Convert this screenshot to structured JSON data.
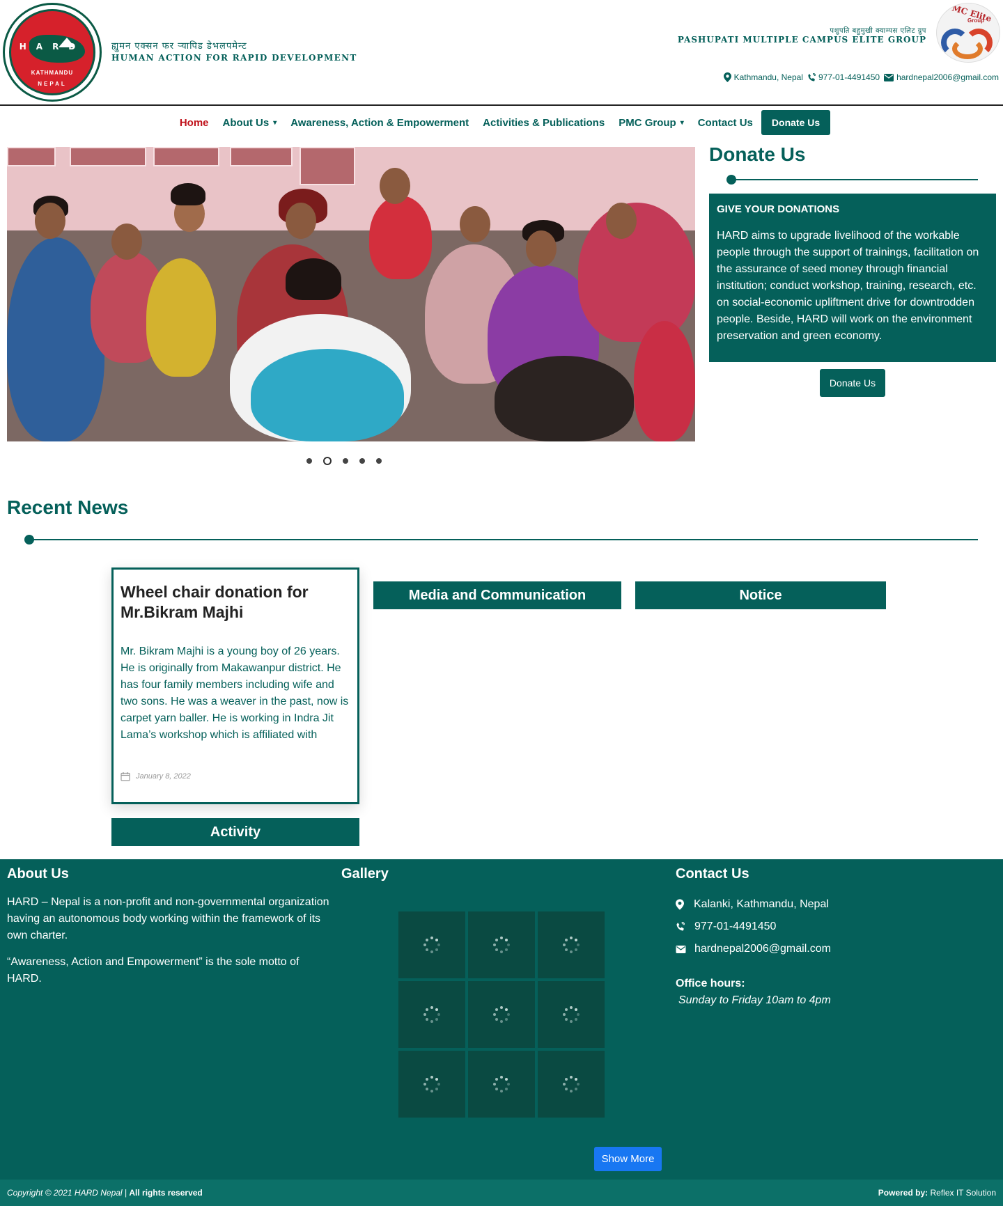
{
  "header": {
    "org_name_nepali": "ह्युमन एक्सन फर र्‍यापिड डेभलपमेन्ट",
    "org_name_english": "HUMAN ACTION FOR RAPID DEVELOPMENT",
    "logo_letters": "HARD",
    "logo_city": "KATHMANDU",
    "logo_country": "NEPAL",
    "pmc_nepali": "पशुपति बहुमुखी क्याम्पस एलिट ग्रुप",
    "pmc_english": "PASHUPATI MULTIPLE CAMPUS ELITE GROUP",
    "pmc_logo_line1": "PMC Elite",
    "pmc_logo_line2": "Group",
    "contact": {
      "location": "Kathmandu, Nepal",
      "phone": "977-01-4491450",
      "email": "hardnepal2006@gmail.com"
    }
  },
  "nav": {
    "items": [
      {
        "label": "Home",
        "active": true,
        "has_dropdown": false
      },
      {
        "label": "About Us",
        "active": false,
        "has_dropdown": true
      },
      {
        "label": "Awareness, Action & Empowerment",
        "active": false,
        "has_dropdown": false
      },
      {
        "label": "Activities & Publications",
        "active": false,
        "has_dropdown": false
      },
      {
        "label": "PMC Group",
        "active": false,
        "has_dropdown": true
      },
      {
        "label": "Contact Us",
        "active": false,
        "has_dropdown": false
      }
    ],
    "donate_label": "Donate Us"
  },
  "slider": {
    "slide_count": 5,
    "current_index": 1
  },
  "donate": {
    "title": "Donate Us",
    "box_heading": "GIVE YOUR DONATIONS",
    "box_text": "HARD aims to upgrade livelihood of the workable people through the support of trainings, facilitation on the assurance of seed money through financial institution; conduct workshop, training, research, etc. on social-economic upliftment drive for downtrodden people. Beside, HARD will work on the environment preservation and green economy.",
    "button_label": "Donate Us"
  },
  "news": {
    "title": "Recent News",
    "card": {
      "title": "Wheel chair donation for Mr.Bikram Majhi",
      "excerpt": "Mr. Bikram Majhi is a young boy of 26 years. He is originally from Makawanpur district. He has four family members including wife and two sons. He was a weaver in the past, now is carpet yarn baller.  He is working in Indra Jit Lama’s workshop which is affiliated with",
      "date": "January 8, 2022"
    },
    "categories": {
      "media": "Media and Communication",
      "notice": "Notice",
      "activity": "Activity"
    }
  },
  "footer": {
    "about": {
      "heading": "About Us",
      "para1": "HARD – Nepal is a non-profit and non-governmental organization having an autonomous body working within the framework of its own charter.",
      "para2": "“Awareness, Action and Empowerment” is the sole motto of HARD."
    },
    "gallery": {
      "heading": "Gallery",
      "show_more": "Show More"
    },
    "contact": {
      "heading": "Contact Us",
      "address": "Kalanki, Kathmandu, Nepal",
      "phone": "977-01-4491450",
      "email": "hardnepal2006@gmail.com",
      "office_hours_label": "Office hours:",
      "office_hours_value": "Sunday to Friday 10am to 4pm"
    },
    "copyright_prefix": "Copyright © 2021 HARD Nepal | ",
    "copyright_rights": "All rights reserved",
    "powered_label": "Powered by:",
    "powered_value": "Reflex IT Solution"
  },
  "colors": {
    "brand_teal": "#05605a",
    "nav_active": "#c0121b",
    "show_more_blue": "#1877f2",
    "footer_bottom": "#0c7068"
  }
}
